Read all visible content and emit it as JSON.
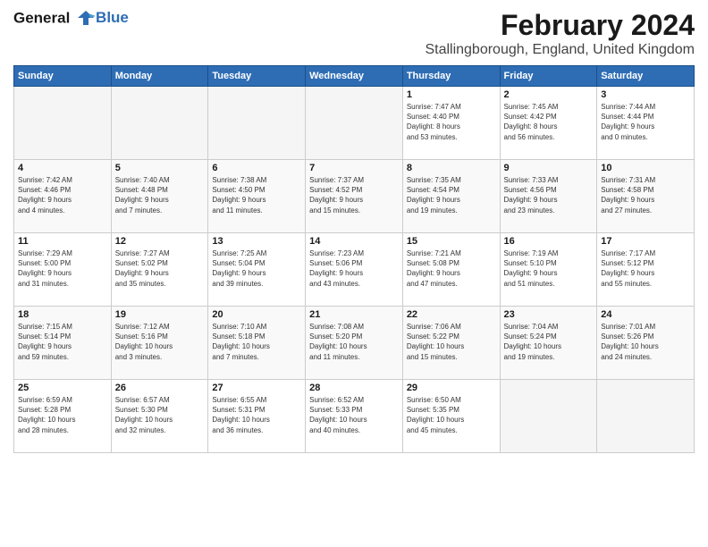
{
  "header": {
    "logo_line1": "General",
    "logo_line2": "Blue",
    "title": "February 2024",
    "subtitle": "Stallingborough, England, United Kingdom"
  },
  "days_of_week": [
    "Sunday",
    "Monday",
    "Tuesday",
    "Wednesday",
    "Thursday",
    "Friday",
    "Saturday"
  ],
  "weeks": [
    [
      {
        "day": "",
        "info": ""
      },
      {
        "day": "",
        "info": ""
      },
      {
        "day": "",
        "info": ""
      },
      {
        "day": "",
        "info": ""
      },
      {
        "day": "1",
        "info": "Sunrise: 7:47 AM\nSunset: 4:40 PM\nDaylight: 8 hours\nand 53 minutes."
      },
      {
        "day": "2",
        "info": "Sunrise: 7:45 AM\nSunset: 4:42 PM\nDaylight: 8 hours\nand 56 minutes."
      },
      {
        "day": "3",
        "info": "Sunrise: 7:44 AM\nSunset: 4:44 PM\nDaylight: 9 hours\nand 0 minutes."
      }
    ],
    [
      {
        "day": "4",
        "info": "Sunrise: 7:42 AM\nSunset: 4:46 PM\nDaylight: 9 hours\nand 4 minutes."
      },
      {
        "day": "5",
        "info": "Sunrise: 7:40 AM\nSunset: 4:48 PM\nDaylight: 9 hours\nand 7 minutes."
      },
      {
        "day": "6",
        "info": "Sunrise: 7:38 AM\nSunset: 4:50 PM\nDaylight: 9 hours\nand 11 minutes."
      },
      {
        "day": "7",
        "info": "Sunrise: 7:37 AM\nSunset: 4:52 PM\nDaylight: 9 hours\nand 15 minutes."
      },
      {
        "day": "8",
        "info": "Sunrise: 7:35 AM\nSunset: 4:54 PM\nDaylight: 9 hours\nand 19 minutes."
      },
      {
        "day": "9",
        "info": "Sunrise: 7:33 AM\nSunset: 4:56 PM\nDaylight: 9 hours\nand 23 minutes."
      },
      {
        "day": "10",
        "info": "Sunrise: 7:31 AM\nSunset: 4:58 PM\nDaylight: 9 hours\nand 27 minutes."
      }
    ],
    [
      {
        "day": "11",
        "info": "Sunrise: 7:29 AM\nSunset: 5:00 PM\nDaylight: 9 hours\nand 31 minutes."
      },
      {
        "day": "12",
        "info": "Sunrise: 7:27 AM\nSunset: 5:02 PM\nDaylight: 9 hours\nand 35 minutes."
      },
      {
        "day": "13",
        "info": "Sunrise: 7:25 AM\nSunset: 5:04 PM\nDaylight: 9 hours\nand 39 minutes."
      },
      {
        "day": "14",
        "info": "Sunrise: 7:23 AM\nSunset: 5:06 PM\nDaylight: 9 hours\nand 43 minutes."
      },
      {
        "day": "15",
        "info": "Sunrise: 7:21 AM\nSunset: 5:08 PM\nDaylight: 9 hours\nand 47 minutes."
      },
      {
        "day": "16",
        "info": "Sunrise: 7:19 AM\nSunset: 5:10 PM\nDaylight: 9 hours\nand 51 minutes."
      },
      {
        "day": "17",
        "info": "Sunrise: 7:17 AM\nSunset: 5:12 PM\nDaylight: 9 hours\nand 55 minutes."
      }
    ],
    [
      {
        "day": "18",
        "info": "Sunrise: 7:15 AM\nSunset: 5:14 PM\nDaylight: 9 hours\nand 59 minutes."
      },
      {
        "day": "19",
        "info": "Sunrise: 7:12 AM\nSunset: 5:16 PM\nDaylight: 10 hours\nand 3 minutes."
      },
      {
        "day": "20",
        "info": "Sunrise: 7:10 AM\nSunset: 5:18 PM\nDaylight: 10 hours\nand 7 minutes."
      },
      {
        "day": "21",
        "info": "Sunrise: 7:08 AM\nSunset: 5:20 PM\nDaylight: 10 hours\nand 11 minutes."
      },
      {
        "day": "22",
        "info": "Sunrise: 7:06 AM\nSunset: 5:22 PM\nDaylight: 10 hours\nand 15 minutes."
      },
      {
        "day": "23",
        "info": "Sunrise: 7:04 AM\nSunset: 5:24 PM\nDaylight: 10 hours\nand 19 minutes."
      },
      {
        "day": "24",
        "info": "Sunrise: 7:01 AM\nSunset: 5:26 PM\nDaylight: 10 hours\nand 24 minutes."
      }
    ],
    [
      {
        "day": "25",
        "info": "Sunrise: 6:59 AM\nSunset: 5:28 PM\nDaylight: 10 hours\nand 28 minutes."
      },
      {
        "day": "26",
        "info": "Sunrise: 6:57 AM\nSunset: 5:30 PM\nDaylight: 10 hours\nand 32 minutes."
      },
      {
        "day": "27",
        "info": "Sunrise: 6:55 AM\nSunset: 5:31 PM\nDaylight: 10 hours\nand 36 minutes."
      },
      {
        "day": "28",
        "info": "Sunrise: 6:52 AM\nSunset: 5:33 PM\nDaylight: 10 hours\nand 40 minutes."
      },
      {
        "day": "29",
        "info": "Sunrise: 6:50 AM\nSunset: 5:35 PM\nDaylight: 10 hours\nand 45 minutes."
      },
      {
        "day": "",
        "info": ""
      },
      {
        "day": "",
        "info": ""
      }
    ]
  ]
}
